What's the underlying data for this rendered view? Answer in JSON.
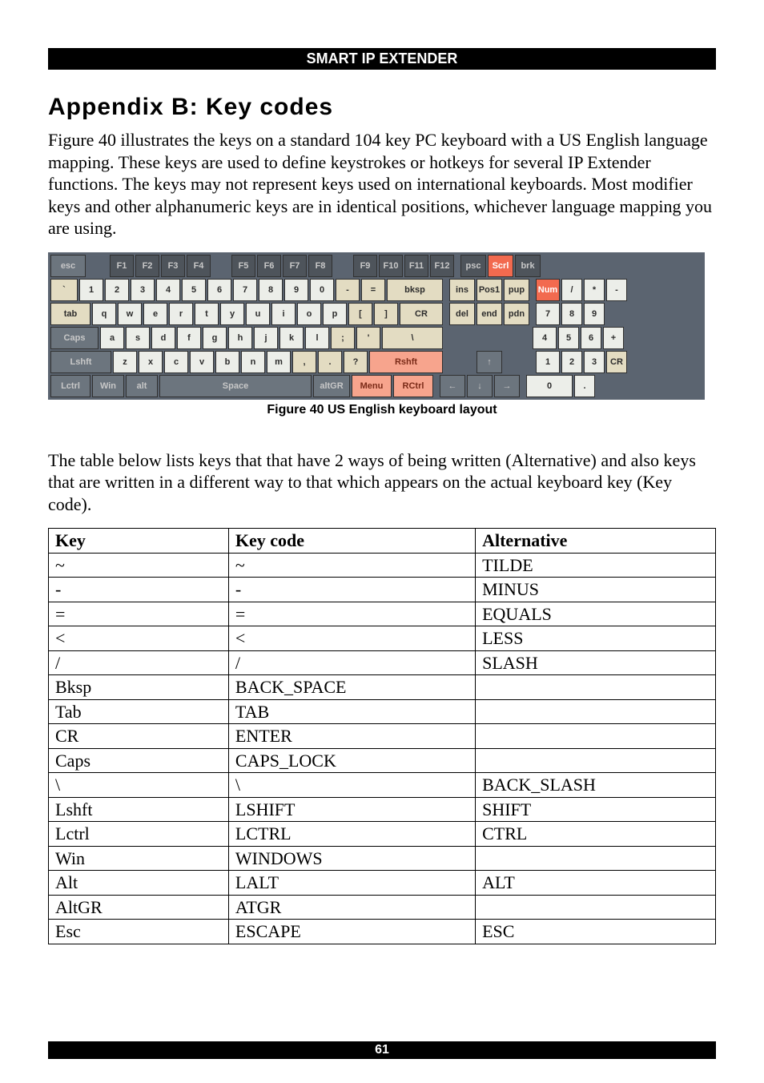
{
  "header": "SMART IP EXTENDER",
  "title": "Appendix B: Key codes",
  "intro": "Figure 40 illustrates the keys on a standard 104 key PC keyboard with a US English language mapping. These keys are used to define keystrokes or hotkeys for several IP Extender functions. The keys may not represent keys used on international keyboards. Most modifier keys and other alphanumeric keys are in identical positions, whichever language mapping you are using.",
  "figure_caption": "Figure 40 US English keyboard layout",
  "para2": "The table below lists keys that that have 2 ways of being written (Alternative) and also keys that are written in a different way to that which appears on the actual keyboard key (Key code).",
  "table": {
    "headers": {
      "c1": "Key",
      "c2": "Key code",
      "c3": "Alternative"
    },
    "rows": [
      {
        "c1": "~",
        "c2": "~",
        "c3": "TILDE"
      },
      {
        "c1": "-",
        "c2": "-",
        "c3": "MINUS"
      },
      {
        "c1": "=",
        "c2": "=",
        "c3": "EQUALS"
      },
      {
        "c1": "<",
        "c2": "<",
        "c3": "LESS"
      },
      {
        "c1": "/",
        "c2": "/",
        "c3": "SLASH"
      },
      {
        "c1": "Bksp",
        "c2": "BACK_SPACE",
        "c3": ""
      },
      {
        "c1": "Tab",
        "c2": "TAB",
        "c3": ""
      },
      {
        "c1": "CR",
        "c2": "ENTER",
        "c3": ""
      },
      {
        "c1": "Caps",
        "c2": "CAPS_LOCK",
        "c3": ""
      },
      {
        "c1": "\\",
        "c2": "\\",
        "c3": "BACK_SLASH"
      },
      {
        "c1": "Lshft",
        "c2": "LSHIFT",
        "c3": "SHIFT"
      },
      {
        "c1": "Lctrl",
        "c2": "LCTRL",
        "c3": "CTRL"
      },
      {
        "c1": "Win",
        "c2": "WINDOWS",
        "c3": ""
      },
      {
        "c1": "Alt",
        "c2": "LALT",
        "c3": "ALT"
      },
      {
        "c1": "AltGR",
        "c2": "ATGR",
        "c3": ""
      },
      {
        "c1": "Esc",
        "c2": "ESCAPE",
        "c3": "ESC"
      }
    ]
  },
  "kbd": {
    "r1": {
      "esc": "esc",
      "f1": "F1",
      "f2": "F2",
      "f3": "F3",
      "f4": "F4",
      "f5": "F5",
      "f6": "F6",
      "f7": "F7",
      "f8": "F8",
      "f9": "F9",
      "f10": "F10",
      "f11": "F11",
      "f12": "F12",
      "psc": "psc",
      "scr": "Scrl",
      "brk": "brk"
    },
    "r2": {
      "tilde": "`",
      "k1": "1",
      "k2": "2",
      "k3": "3",
      "k4": "4",
      "k5": "5",
      "k6": "6",
      "k7": "7",
      "k8": "8",
      "k9": "9",
      "k0": "0",
      "minus": "-",
      "eq": "=",
      "bksp": "bksp",
      "ins": "ins",
      "pos1": "Pos1",
      "pup": "pup",
      "num": "Num",
      "div": "/",
      "mul": "*",
      "sub": "-"
    },
    "r3": {
      "tab": "tab",
      "q": "q",
      "w": "w",
      "e": "e",
      "r": "r",
      "t": "t",
      "y": "y",
      "u": "u",
      "i": "i",
      "o": "o",
      "p": "p",
      "lb": "[",
      "rb": "]",
      "cr": "CR",
      "del": "del",
      "end": "end",
      "pdn": "pdn",
      "n7": "7",
      "n8": "8",
      "n9": "9"
    },
    "r4": {
      "caps": "Caps",
      "a": "a",
      "s": "s",
      "d": "d",
      "f": "f",
      "g": "g",
      "h": "h",
      "j": "j",
      "k": "k",
      "l": "l",
      "semi": ";",
      "ap": "'",
      "bs": "\\",
      "n4": "4",
      "n5": "5",
      "n6": "6",
      "plus": "+"
    },
    "r5": {
      "lshft": "Lshft",
      "z": "z",
      "x": "x",
      "c": "c",
      "v": "v",
      "b": "b",
      "n": "n",
      "m": "m",
      "com": ",",
      "dot": ".",
      "sl": "?",
      "rshft": "Rshft",
      "up": "↑",
      "n1": "1",
      "n2": "2",
      "n3": "3",
      "cr": "CR"
    },
    "r6": {
      "lctrl": "Lctrl",
      "win": "Win",
      "alt": "alt",
      "space": "Space",
      "altgr": "altGR",
      "menu": "Menu",
      "rctrl": "RCtrl",
      "left": "←",
      "down": "↓",
      "right": "→",
      "n0": "0",
      "ndot": "."
    }
  },
  "page_number": "61"
}
